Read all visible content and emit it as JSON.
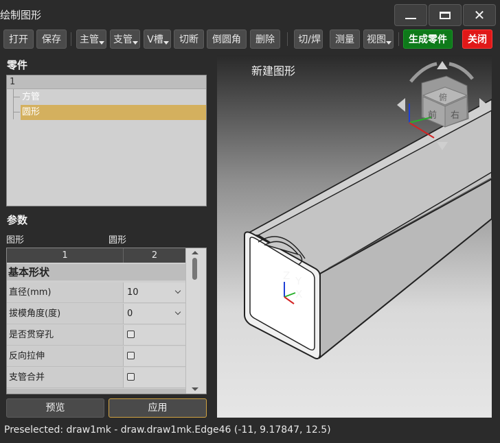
{
  "window": {
    "title": "绘制图形"
  },
  "toolbar": {
    "items": [
      "打开",
      "保存",
      "主管",
      "支管",
      "V槽",
      "切断",
      "倒圆角",
      "删除",
      "切/焊",
      "测量",
      "视图"
    ],
    "generate": "生成零件",
    "close": "关闭"
  },
  "parts": {
    "section_title": "零件",
    "tree_header": "1",
    "items": [
      "方管",
      "圆形"
    ],
    "selected": "圆形"
  },
  "params": {
    "section_title": "参数",
    "col_left_label": "图形",
    "col_right_label": "圆形",
    "headers": [
      "1",
      "2"
    ],
    "category": "基本形状",
    "rows": [
      {
        "key": "直径(mm)",
        "value": "10",
        "kind": "select"
      },
      {
        "key": "拔模角度(度)",
        "value": "0",
        "kind": "select"
      },
      {
        "key": "是否贯穿孔",
        "value": "",
        "kind": "checkbox"
      },
      {
        "key": "反向拉伸",
        "value": "",
        "kind": "checkbox"
      },
      {
        "key": "支管合并",
        "value": "",
        "kind": "checkbox"
      }
    ]
  },
  "actions": {
    "preview": "预览",
    "apply": "应用"
  },
  "viewport": {
    "title": "新建图形",
    "navcube": {
      "face_front": "前",
      "face_right": "右",
      "face_top": "俯"
    },
    "axes": {
      "x": "X",
      "y": "Y",
      "z": "Z"
    }
  },
  "status": {
    "text": "Preselected: draw1mk - draw.draw1mk.Edge46 (-11, 9.17847, 12.5)"
  },
  "colors": {
    "accent_selected": "#d4b05e",
    "generate_bg": "#0e7a1a",
    "close_bg": "#e01818",
    "apply_border": "#d2a442"
  }
}
